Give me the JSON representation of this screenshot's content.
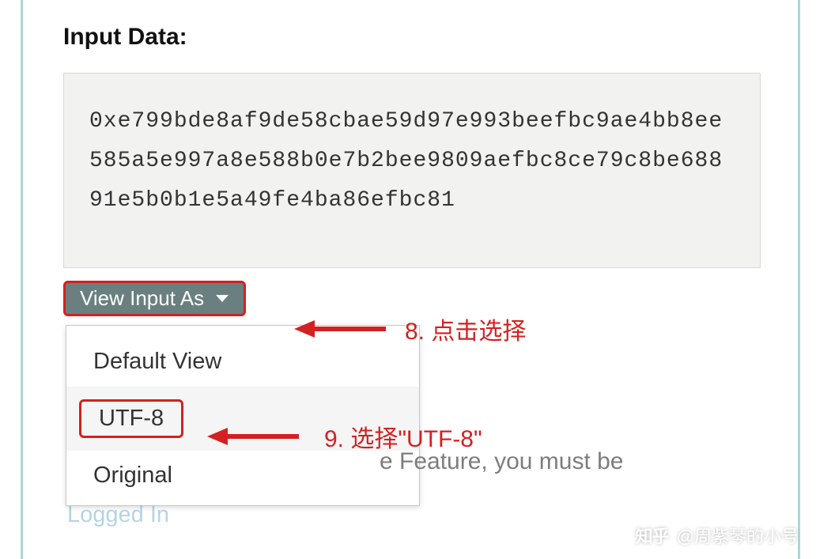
{
  "section": {
    "title": "Input Data:"
  },
  "hex_data": "0xe799bde8af9de58cbae59d97e993beefbc9ae4bb8ee585a5e997a8e588b0e7b2bee9809aefbc8ce79c8be68891e5b0b1e5a49fe4ba86efbc81",
  "dropdown": {
    "button_label": "View Input As",
    "items": [
      {
        "label": "Default View"
      },
      {
        "label": "UTF-8"
      },
      {
        "label": "Original"
      }
    ]
  },
  "annotations": {
    "step8": "8. 点击选择",
    "step9": "9. 选择\"UTF-8\""
  },
  "hint_text": "e Feature, you must be",
  "logged_fragment": "Logged In",
  "watermark": {
    "site": "知乎",
    "author": "@周紫琴的小号"
  },
  "colors": {
    "border": "#a8d8d8",
    "highlight": "#d42020",
    "dropdown_bg": "#6a8080"
  }
}
